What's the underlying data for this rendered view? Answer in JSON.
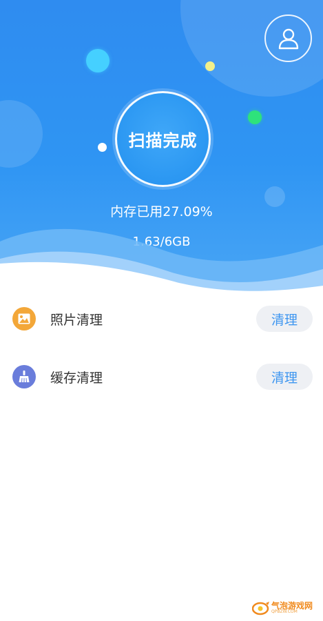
{
  "header": {
    "scan_status": "扫描完成",
    "memory_used": "内存已用27.09%",
    "memory_usage_percent": 27.09,
    "memory_total": "1.63/6GB",
    "profile_icon": "user-icon"
  },
  "list": {
    "items": [
      {
        "label": "照片清理",
        "button_label": "清理",
        "icon": "photo-icon",
        "icon_color": "#f3a739"
      },
      {
        "label": "缓存清理",
        "button_label": "清理",
        "icon": "broom-icon",
        "icon_color": "#6a7ddb"
      }
    ]
  },
  "colors": {
    "header_blue": "#2f8cf0",
    "button_bg": "#eef0f4",
    "button_text": "#3e96f0"
  },
  "watermark": {
    "text": "气泡游戏网",
    "sub": "QPBZW.COM"
  }
}
